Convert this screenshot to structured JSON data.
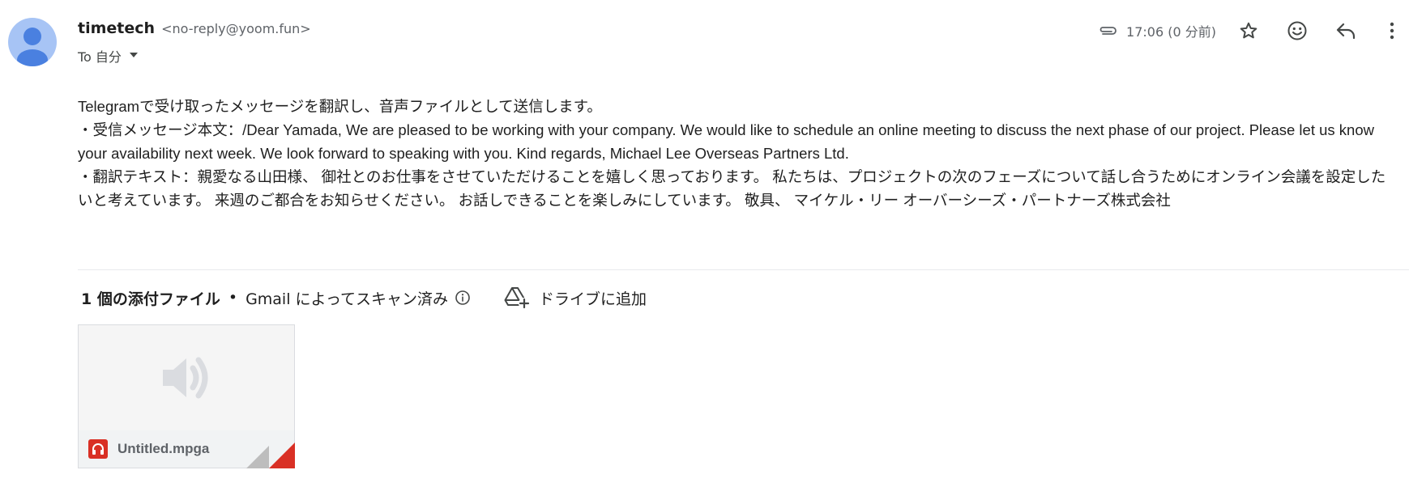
{
  "sender": {
    "name": "timetech",
    "email": "<no-reply@yoom.fun>",
    "to_label": "To 自分"
  },
  "meta": {
    "time": "17:06 (0 分前)",
    "icons": [
      "attachment-icon",
      "star-icon",
      "emoji-icon",
      "reply-icon",
      "more-vert-icon"
    ]
  },
  "body": {
    "lines": [
      "Telegramで受け取ったメッセージを翻訳し、音声ファイルとして送信します。",
      "・受信メッセージ本文：/Dear Yamada, We are pleased to be working with your company. We would like to schedule an online meeting to discuss the next phase of our project. Please let us know your availability next week. We look forward to speaking with you. Kind regards, Michael Lee Overseas Partners Ltd.",
      "・翻訳テキスト：親愛なる山田様、 御社とのお仕事をさせていただけることを嬉しく思っております。 私たちは、プロジェクトの次のフェーズについて話し合うためにオンライン会議を設定したいと考えています。 来週のご都合をお知らせください。 お話しできることを楽しみにしています。 敬具、 マイケル・リー オーバーシーズ・パートナーズ株式会社"
    ]
  },
  "attachments": {
    "count_label": "1 個の添付ファイル",
    "separator": "•",
    "scan_label": "Gmail によってスキャン済み",
    "drive_label": "ドライブに追加",
    "files": [
      {
        "name": "Untitled.mpga",
        "type_icon": "audio-file-icon",
        "preview_icon": "speaker-icon"
      }
    ]
  },
  "colors": {
    "avatar_bg": "#a7c4f5",
    "avatar_fg": "#4a80e0",
    "audio_red": "#d93025",
    "muted_text": "#5f6368"
  }
}
